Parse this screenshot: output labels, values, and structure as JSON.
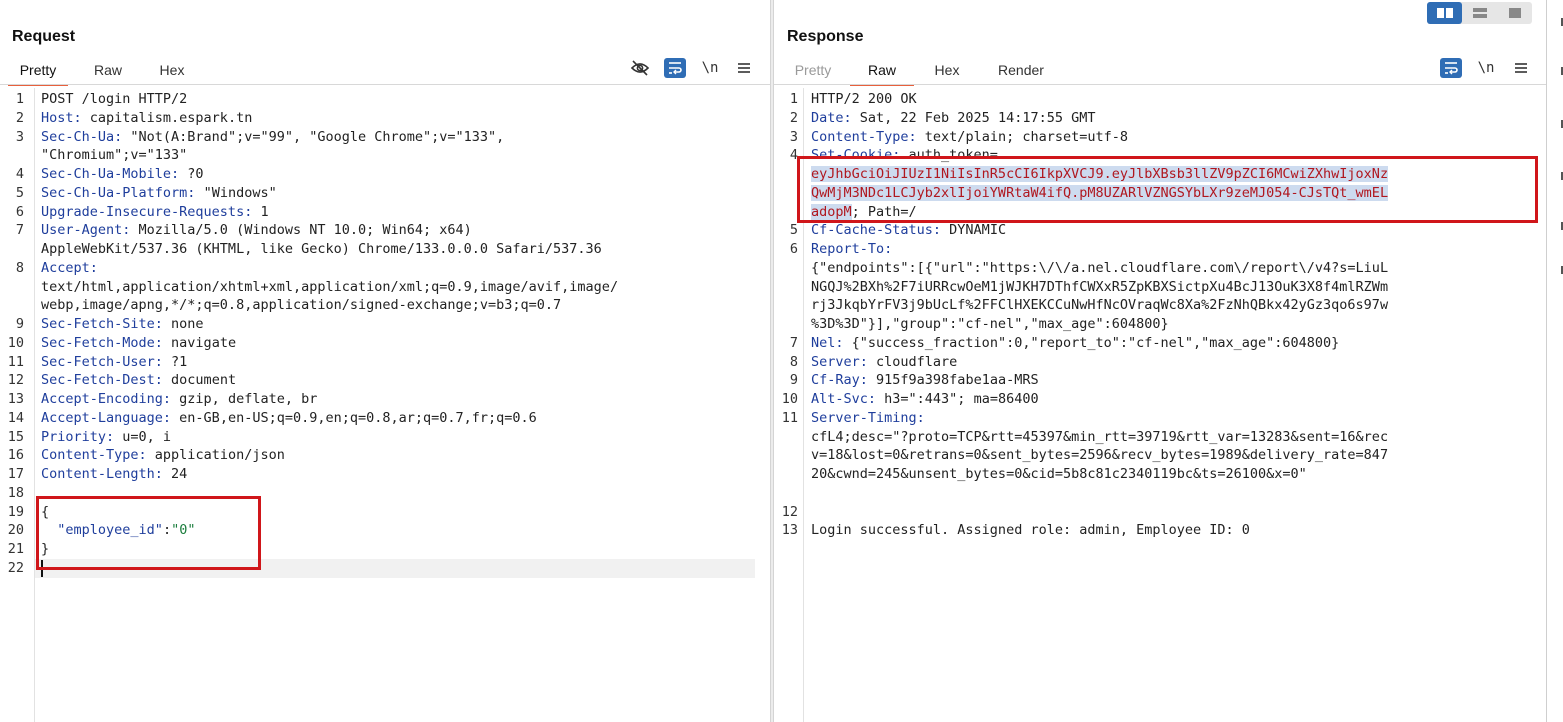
{
  "request": {
    "title": "Request",
    "tabs": [
      {
        "label": "Pretty",
        "active": true
      },
      {
        "label": "Raw",
        "active": false
      },
      {
        "label": "Hex",
        "active": false
      }
    ],
    "toolbar": {
      "newline_label": "\\n"
    },
    "lines": [
      {
        "n": "1",
        "parts": [
          [
            "t",
            "POST /login HTTP/2"
          ]
        ]
      },
      {
        "n": "2",
        "parts": [
          [
            "k",
            "Host:"
          ],
          [
            "t",
            " capitalism.espark.tn"
          ]
        ]
      },
      {
        "n": "3",
        "parts": [
          [
            "k",
            "Sec-Ch-Ua:"
          ],
          [
            "t",
            " \"Not(A:Brand\";v=\"99\", \"Google Chrome\";v=\"133\","
          ]
        ]
      },
      {
        "n": "",
        "parts": [
          [
            "t",
            "\"Chromium\";v=\"133\""
          ]
        ]
      },
      {
        "n": "4",
        "parts": [
          [
            "k",
            "Sec-Ch-Ua-Mobile:"
          ],
          [
            "t",
            " ?0"
          ]
        ]
      },
      {
        "n": "5",
        "parts": [
          [
            "k",
            "Sec-Ch-Ua-Platform:"
          ],
          [
            "t",
            " \"Windows\""
          ]
        ]
      },
      {
        "n": "6",
        "parts": [
          [
            "k",
            "Upgrade-Insecure-Requests:"
          ],
          [
            "t",
            " 1"
          ]
        ]
      },
      {
        "n": "7",
        "parts": [
          [
            "k",
            "User-Agent:"
          ],
          [
            "t",
            " Mozilla/5.0 (Windows NT 10.0; Win64; x64)"
          ]
        ]
      },
      {
        "n": "",
        "parts": [
          [
            "t",
            "AppleWebKit/537.36 (KHTML, like Gecko) Chrome/133.0.0.0 Safari/537.36"
          ]
        ]
      },
      {
        "n": "8",
        "parts": [
          [
            "k",
            "Accept:"
          ]
        ]
      },
      {
        "n": "",
        "parts": [
          [
            "t",
            "text/html,application/xhtml+xml,application/xml;q=0.9,image/avif,image/"
          ]
        ]
      },
      {
        "n": "",
        "parts": [
          [
            "t",
            "webp,image/apng,*/*;q=0.8,application/signed-exchange;v=b3;q=0.7"
          ]
        ]
      },
      {
        "n": "9",
        "parts": [
          [
            "k",
            "Sec-Fetch-Site:"
          ],
          [
            "t",
            " none"
          ]
        ]
      },
      {
        "n": "10",
        "parts": [
          [
            "k",
            "Sec-Fetch-Mode:"
          ],
          [
            "t",
            " navigate"
          ]
        ]
      },
      {
        "n": "11",
        "parts": [
          [
            "k",
            "Sec-Fetch-User:"
          ],
          [
            "t",
            " ?1"
          ]
        ]
      },
      {
        "n": "12",
        "parts": [
          [
            "k",
            "Sec-Fetch-Dest:"
          ],
          [
            "t",
            " document"
          ]
        ]
      },
      {
        "n": "13",
        "parts": [
          [
            "k",
            "Accept-Encoding:"
          ],
          [
            "t",
            " gzip, deflate, br"
          ]
        ]
      },
      {
        "n": "14",
        "parts": [
          [
            "k",
            "Accept-Language:"
          ],
          [
            "t",
            " en-GB,en-US;q=0.9,en;q=0.8,ar;q=0.7,fr;q=0.6"
          ]
        ]
      },
      {
        "n": "15",
        "parts": [
          [
            "k",
            "Priority:"
          ],
          [
            "t",
            " u=0, i"
          ]
        ]
      },
      {
        "n": "16",
        "parts": [
          [
            "k",
            "Content-Type:"
          ],
          [
            "t",
            " application/json"
          ]
        ]
      },
      {
        "n": "17",
        "parts": [
          [
            "k",
            "Content-Length:"
          ],
          [
            "t",
            " 24"
          ]
        ]
      },
      {
        "n": "18",
        "parts": [
          [
            "t",
            ""
          ]
        ]
      },
      {
        "n": "19",
        "parts": [
          [
            "t",
            "{"
          ]
        ]
      },
      {
        "n": "20",
        "parts": [
          [
            "t",
            "  "
          ],
          [
            "jk",
            "\"employee_id\""
          ],
          [
            "t",
            ":"
          ],
          [
            "jv",
            "\"0\""
          ]
        ]
      },
      {
        "n": "21",
        "parts": [
          [
            "t",
            "}"
          ]
        ]
      },
      {
        "n": "22",
        "parts": [
          [
            "t",
            ""
          ]
        ]
      }
    ]
  },
  "response": {
    "title": "Response",
    "tabs": [
      {
        "label": "Pretty",
        "active": false,
        "muted": true
      },
      {
        "label": "Raw",
        "active": true
      },
      {
        "label": "Hex",
        "active": false
      },
      {
        "label": "Render",
        "active": false
      }
    ],
    "toolbar": {
      "newline_label": "\\n"
    },
    "lines": [
      {
        "n": "1",
        "parts": [
          [
            "t",
            "HTTP/2 200 OK"
          ]
        ]
      },
      {
        "n": "2",
        "parts": [
          [
            "k",
            "Date:"
          ],
          [
            "t",
            " Sat, 22 Feb 2025 14:17:55 GMT"
          ]
        ]
      },
      {
        "n": "3",
        "parts": [
          [
            "k",
            "Content-Type:"
          ],
          [
            "t",
            " text/plain; charset=utf-8"
          ]
        ]
      },
      {
        "n": "4",
        "parts": [
          [
            "k",
            "Set-Cookie:"
          ],
          [
            "t",
            " auth_token="
          ]
        ]
      },
      {
        "n": "",
        "parts": [
          [
            "tok",
            "eyJhbGciOiJIUzI1NiIsInR5cCI6IkpXVCJ9.eyJlbXBsb3llZV9pZCI6MCwiZXhwIjoxNz"
          ]
        ]
      },
      {
        "n": "",
        "parts": [
          [
            "tok",
            "QwMjM3NDc1LCJyb2xlIjoiYWRtaW4ifQ.pM8UZARlVZNGSYbLXr9zeMJ054-CJsTQt_wmEL"
          ]
        ]
      },
      {
        "n": "",
        "parts": [
          [
            "tok",
            "adopM"
          ],
          [
            "t",
            "; Path=/"
          ]
        ]
      },
      {
        "n": "5",
        "parts": [
          [
            "k",
            "Cf-Cache-Status:"
          ],
          [
            "t",
            " DYNAMIC"
          ]
        ]
      },
      {
        "n": "6",
        "parts": [
          [
            "k",
            "Report-To:"
          ]
        ]
      },
      {
        "n": "",
        "parts": [
          [
            "t",
            "{\"endpoints\":[{\"url\":\"https:\\/\\/a.nel.cloudflare.com\\/report\\/v4?s=LiuL"
          ]
        ]
      },
      {
        "n": "",
        "parts": [
          [
            "t",
            "NGQJ%2BXh%2F7iURRcwOeM1jWJKH7DThfCWXxR5ZpKBXSictpXu4BcJ13OuK3X8f4mlRZWm"
          ]
        ]
      },
      {
        "n": "",
        "parts": [
          [
            "t",
            "rj3JkqbYrFV3j9bUcLf%2FFClHXEKCCuNwHfNcOVraqWc8Xa%2FzNhQBkx42yGz3qo6s97w"
          ]
        ]
      },
      {
        "n": "",
        "parts": [
          [
            "t",
            "%3D%3D\"}],\"group\":\"cf-nel\",\"max_age\":604800}"
          ]
        ]
      },
      {
        "n": "7",
        "parts": [
          [
            "k",
            "Nel:"
          ],
          [
            "t",
            " {\"success_fraction\":0,\"report_to\":\"cf-nel\",\"max_age\":604800}"
          ]
        ]
      },
      {
        "n": "8",
        "parts": [
          [
            "k",
            "Server:"
          ],
          [
            "t",
            " cloudflare"
          ]
        ]
      },
      {
        "n": "9",
        "parts": [
          [
            "k",
            "Cf-Ray:"
          ],
          [
            "t",
            " 915f9a398fabe1aa-MRS"
          ]
        ]
      },
      {
        "n": "10",
        "parts": [
          [
            "k",
            "Alt-Svc:"
          ],
          [
            "t",
            " h3=\":443\"; ma=86400"
          ]
        ]
      },
      {
        "n": "11",
        "parts": [
          [
            "k",
            "Server-Timing:"
          ]
        ]
      },
      {
        "n": "",
        "parts": [
          [
            "t",
            "cfL4;desc=\"?proto=TCP&rtt=45397&min_rtt=39719&rtt_var=13283&sent=16&rec"
          ]
        ]
      },
      {
        "n": "",
        "parts": [
          [
            "t",
            "v=18&lost=0&retrans=0&sent_bytes=2596&recv_bytes=1989&delivery_rate=847"
          ]
        ]
      },
      {
        "n": "",
        "parts": [
          [
            "t",
            "20&cwnd=245&unsent_bytes=0&cid=5b8c81c2340119bc&ts=26100&x=0\""
          ]
        ]
      },
      {
        "n": "",
        "parts": [
          [
            "t",
            ""
          ]
        ]
      },
      {
        "n": "12",
        "parts": [
          [
            "t",
            ""
          ]
        ]
      },
      {
        "n": "13",
        "parts": [
          [
            "t",
            "Login successful. Assigned role: admin, Employee ID: 0"
          ]
        ]
      }
    ]
  },
  "colors": {
    "accent": "#2f6db5",
    "tab_underline": "#e8603c",
    "highlight_box": "#d0161a"
  }
}
